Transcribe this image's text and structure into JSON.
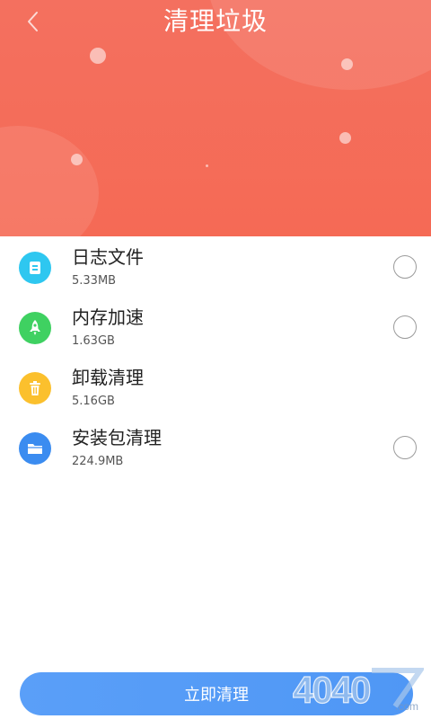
{
  "header": {
    "title": "清理垃圾",
    "back_icon": "chevron-left-icon",
    "gradient_colors": [
      "#f4705f",
      "#f56a55"
    ]
  },
  "items": [
    {
      "name": "日志文件",
      "size": "5.33MB",
      "icon": "document-icon",
      "icon_color": "#2ec7f0",
      "checked": false,
      "show_radio": true
    },
    {
      "name": "内存加速",
      "size": "1.63GB",
      "icon": "rocket-icon",
      "icon_color": "#3fd161",
      "checked": false,
      "show_radio": true
    },
    {
      "name": "卸载清理",
      "size": "5.16GB",
      "icon": "trash-icon",
      "icon_color": "#fbc02d",
      "checked": false,
      "show_radio": false
    },
    {
      "name": "安装包清理",
      "size": "224.9MB",
      "icon": "folder-icon",
      "icon_color": "#3b8cf0",
      "checked": false,
      "show_radio": true
    }
  ],
  "action": {
    "label": "立即清理",
    "color": "#5a9ff8"
  },
  "watermark": {
    "text": "4040",
    "suffix": ".com"
  }
}
